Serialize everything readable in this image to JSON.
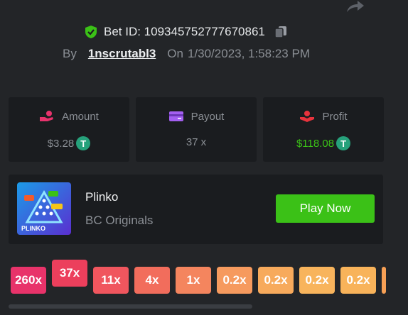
{
  "bet": {
    "id_label": "Bet ID: 109345752777670861",
    "by_label": "By",
    "username": "1nscrutabl3",
    "on_label": "On",
    "datetime": "1/30/2023, 1:58:23 PM"
  },
  "stats": {
    "amount": {
      "label": "Amount",
      "value": "$3.28",
      "icon": "amount-icon"
    },
    "payout": {
      "label": "Payout",
      "value": "37 x",
      "icon": "wallet-icon"
    },
    "profit": {
      "label": "Profit",
      "value": "$118.08",
      "icon": "profit-icon"
    }
  },
  "currency_symbol": "T",
  "game": {
    "name": "Plinko",
    "provider": "BC Originals",
    "thumb_label": "PLINKO",
    "play_label": "Play Now"
  },
  "multipliers": [
    "260x",
    "37x",
    "11x",
    "4x",
    "1x",
    "0.2x",
    "0.2x",
    "0.2x",
    "0.2x"
  ],
  "colors": {
    "background": "#232528",
    "card": "#1a1c1f",
    "accent_green": "#3bc117",
    "tether": "#26a17b"
  }
}
